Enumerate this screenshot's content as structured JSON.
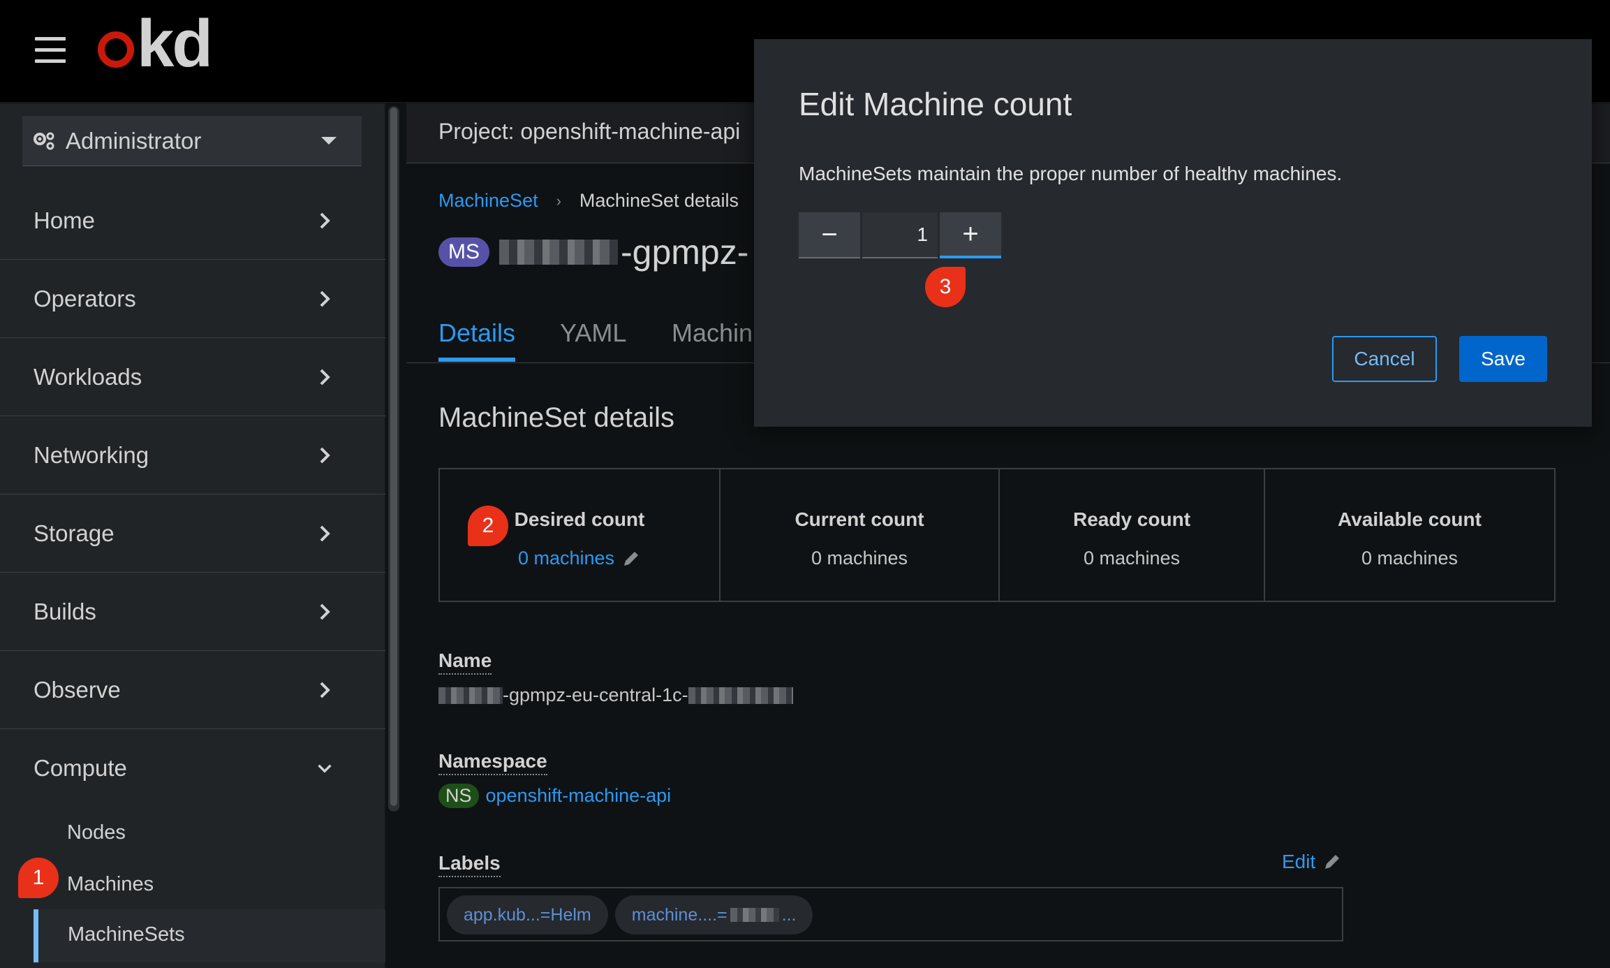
{
  "masthead": {
    "logo_text": "kd"
  },
  "sidebar": {
    "perspective": "Administrator",
    "items": [
      {
        "label": "Home"
      },
      {
        "label": "Operators"
      },
      {
        "label": "Workloads"
      },
      {
        "label": "Networking"
      },
      {
        "label": "Storage"
      },
      {
        "label": "Builds"
      },
      {
        "label": "Observe"
      },
      {
        "label": "Compute"
      }
    ],
    "compute_sub": [
      "Nodes",
      "Machines",
      "MachineSets"
    ]
  },
  "project_bar": {
    "label": "Project: openshift-machine-api"
  },
  "breadcrumb": {
    "parent": "MachineSet",
    "current": "MachineSet details"
  },
  "title": {
    "badge": "MS",
    "name_visible": "-gpmpz-"
  },
  "tabs": [
    "Details",
    "YAML",
    "Machin"
  ],
  "details": {
    "section_title": "MachineSet details",
    "counts": [
      {
        "head": "Desired count",
        "value": "0 machines"
      },
      {
        "head": "Current count",
        "value": "0 machines"
      },
      {
        "head": "Ready count",
        "value": "0 machines"
      },
      {
        "head": "Available count",
        "value": "0 machines"
      }
    ],
    "name_label": "Name",
    "name_visible": "-gpmpz-eu-central-1c-",
    "namespace_label": "Namespace",
    "namespace_badge": "NS",
    "namespace_value": "openshift-machine-api",
    "labels_label": "Labels",
    "edit_label": "Edit",
    "label_chips": [
      "app.kub...=Helm",
      "machine....=",
      "..."
    ]
  },
  "modal": {
    "title": "Edit Machine count",
    "description": "MachineSets maintain the proper number of healthy machines.",
    "minus": "−",
    "plus": "+",
    "count_value": "1",
    "cancel": "Cancel",
    "save": "Save"
  },
  "markers": [
    "1",
    "2",
    "3"
  ],
  "colors": {
    "accent": "#2b9af3",
    "primary_button": "#0066cc",
    "marker": "#e9311a",
    "brand_red": "#c9190b"
  }
}
